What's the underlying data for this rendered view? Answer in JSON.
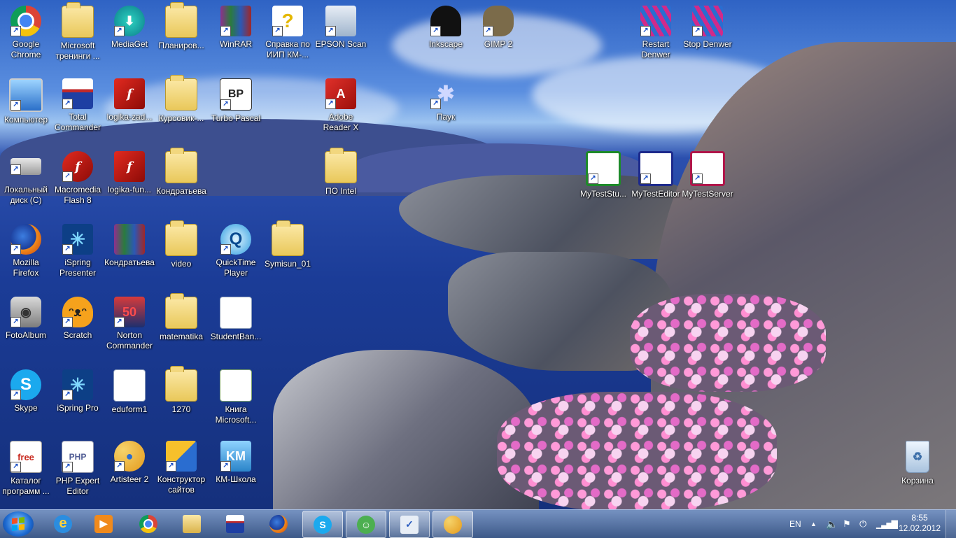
{
  "desktop": {
    "icons": [
      {
        "label": "Google Chrome",
        "icon": "chrome-icon"
      },
      {
        "label": "Microsoft тренинги ...",
        "icon": "folder-icon"
      },
      {
        "label": "MediaGet",
        "icon": "mediaget-icon"
      },
      {
        "label": "Планиров...",
        "icon": "folder-icon"
      },
      {
        "label": "WinRAR",
        "icon": "winrar-icon"
      },
      {
        "label": "Справка по ИИП КМ-...",
        "icon": "help-icon"
      },
      {
        "label": "EPSON Scan",
        "icon": "scanner-icon"
      },
      {
        "label": "Inkscape",
        "icon": "inkscape-icon"
      },
      {
        "label": "GIMP 2",
        "icon": "gimp-icon"
      },
      {
        "label": "Restart Denwer",
        "icon": "denwer-icon"
      },
      {
        "label": "Stop Denwer",
        "icon": "denwer-stop-icon"
      },
      {
        "label": "Компьютер",
        "icon": "computer-icon"
      },
      {
        "label": "Total Commander",
        "icon": "floppy-icon"
      },
      {
        "label": "logika-zad...",
        "icon": "flash-icon"
      },
      {
        "label": "Курсовик-...",
        "icon": "folder-icon"
      },
      {
        "label": "Turbo Pascal",
        "icon": "turbo-pascal-icon"
      },
      {
        "label": "Adobe Reader X",
        "icon": "adobe-reader-icon"
      },
      {
        "label": "Паук",
        "icon": "spider-icon"
      },
      {
        "label": "Локальный диск (C)",
        "icon": "drive-icon"
      },
      {
        "label": "Macromedia Flash 8",
        "icon": "macromedia-flash-icon"
      },
      {
        "label": "logika-fun...",
        "icon": "flash-icon"
      },
      {
        "label": "Кондратьева",
        "icon": "folder-icon"
      },
      {
        "label": "ПО Intel",
        "icon": "folder-icon"
      },
      {
        "label": "MyTestStu...",
        "icon": "mytest-student-icon"
      },
      {
        "label": "MyTestEditor",
        "icon": "mytest-editor-icon"
      },
      {
        "label": "MyTestServer",
        "icon": "mytest-server-icon"
      },
      {
        "label": "Mozilla Firefox",
        "icon": "firefox-icon"
      },
      {
        "label": "iSpring Presenter",
        "icon": "ispring-icon"
      },
      {
        "label": "Кондратьева",
        "icon": "winrar-icon"
      },
      {
        "label": "video",
        "icon": "folder-icon"
      },
      {
        "label": "QuickTime Player",
        "icon": "quicktime-icon"
      },
      {
        "label": "Symisun_01",
        "icon": "folder-icon"
      },
      {
        "label": "FotoAlbum",
        "icon": "camera-icon"
      },
      {
        "label": "Scratch",
        "icon": "scratch-cat-icon"
      },
      {
        "label": "Norton Commander",
        "icon": "norton-commander-icon"
      },
      {
        "label": "matematika",
        "icon": "folder-icon"
      },
      {
        "label": "StudentBan...",
        "icon": "word-doc-icon"
      },
      {
        "label": "Skype",
        "icon": "skype-icon"
      },
      {
        "label": "iSpring Pro",
        "icon": "ispring-icon"
      },
      {
        "label": "eduform1",
        "icon": "word-doc-icon"
      },
      {
        "label": "1270",
        "icon": "folder-icon"
      },
      {
        "label": "Книга Microsoft...",
        "icon": "excel-doc-icon"
      },
      {
        "label": "Каталог программ ...",
        "icon": "freesoft-icon"
      },
      {
        "label": "PHP Expert Editor",
        "icon": "php-editor-icon"
      },
      {
        "label": "Artisteer 2",
        "icon": "palette-icon"
      },
      {
        "label": "Конструктор сайтов",
        "icon": "site-builder-icon"
      },
      {
        "label": "КМ-Школа",
        "icon": "km-school-icon"
      },
      {
        "label": "Корзина",
        "icon": "recycle-bin-icon"
      }
    ]
  },
  "taskbar": {
    "start_icon": "windows-start-icon",
    "pinned": [
      {
        "icon": "internet-explorer-icon"
      },
      {
        "icon": "media-player-icon"
      },
      {
        "icon": "chrome-icon"
      },
      {
        "icon": "file-explorer-icon"
      },
      {
        "icon": "total-commander-icon"
      },
      {
        "icon": "firefox-icon"
      },
      {
        "icon": "skype-icon"
      },
      {
        "icon": "netmeeting-icon"
      },
      {
        "icon": "mytest-icon"
      },
      {
        "icon": "artisteer-icon"
      }
    ],
    "tray": {
      "language": "EN",
      "time": "8:55",
      "date": "12.02.2012"
    }
  },
  "colors": {
    "taskbar": "#4d6fa6",
    "label_text": "#ffffff"
  }
}
